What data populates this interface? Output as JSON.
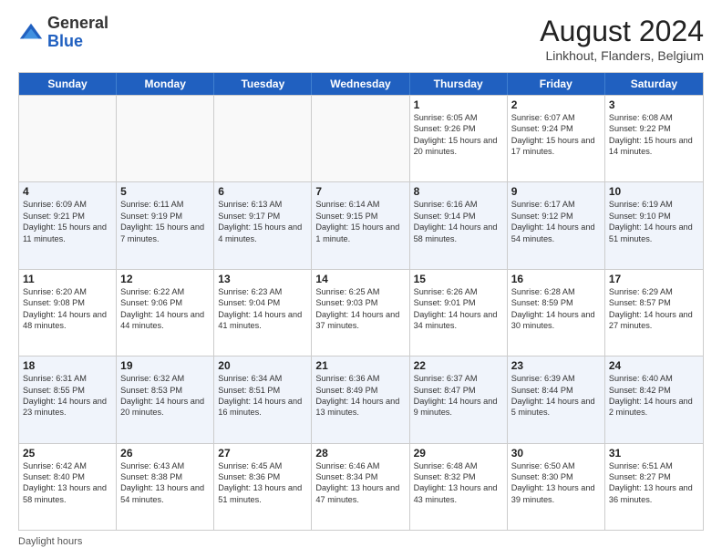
{
  "header": {
    "logo_general": "General",
    "logo_blue": "Blue",
    "month_title": "August 2024",
    "subtitle": "Linkhout, Flanders, Belgium"
  },
  "days_of_week": [
    "Sunday",
    "Monday",
    "Tuesday",
    "Wednesday",
    "Thursday",
    "Friday",
    "Saturday"
  ],
  "footer": {
    "label": "Daylight hours"
  },
  "weeks": [
    [
      {
        "day": "",
        "info": ""
      },
      {
        "day": "",
        "info": ""
      },
      {
        "day": "",
        "info": ""
      },
      {
        "day": "",
        "info": ""
      },
      {
        "day": "1",
        "info": "Sunrise: 6:05 AM\nSunset: 9:26 PM\nDaylight: 15 hours\nand 20 minutes."
      },
      {
        "day": "2",
        "info": "Sunrise: 6:07 AM\nSunset: 9:24 PM\nDaylight: 15 hours\nand 17 minutes."
      },
      {
        "day": "3",
        "info": "Sunrise: 6:08 AM\nSunset: 9:22 PM\nDaylight: 15 hours\nand 14 minutes."
      }
    ],
    [
      {
        "day": "4",
        "info": "Sunrise: 6:09 AM\nSunset: 9:21 PM\nDaylight: 15 hours\nand 11 minutes."
      },
      {
        "day": "5",
        "info": "Sunrise: 6:11 AM\nSunset: 9:19 PM\nDaylight: 15 hours\nand 7 minutes."
      },
      {
        "day": "6",
        "info": "Sunrise: 6:13 AM\nSunset: 9:17 PM\nDaylight: 15 hours\nand 4 minutes."
      },
      {
        "day": "7",
        "info": "Sunrise: 6:14 AM\nSunset: 9:15 PM\nDaylight: 15 hours\nand 1 minute."
      },
      {
        "day": "8",
        "info": "Sunrise: 6:16 AM\nSunset: 9:14 PM\nDaylight: 14 hours\nand 58 minutes."
      },
      {
        "day": "9",
        "info": "Sunrise: 6:17 AM\nSunset: 9:12 PM\nDaylight: 14 hours\nand 54 minutes."
      },
      {
        "day": "10",
        "info": "Sunrise: 6:19 AM\nSunset: 9:10 PM\nDaylight: 14 hours\nand 51 minutes."
      }
    ],
    [
      {
        "day": "11",
        "info": "Sunrise: 6:20 AM\nSunset: 9:08 PM\nDaylight: 14 hours\nand 48 minutes."
      },
      {
        "day": "12",
        "info": "Sunrise: 6:22 AM\nSunset: 9:06 PM\nDaylight: 14 hours\nand 44 minutes."
      },
      {
        "day": "13",
        "info": "Sunrise: 6:23 AM\nSunset: 9:04 PM\nDaylight: 14 hours\nand 41 minutes."
      },
      {
        "day": "14",
        "info": "Sunrise: 6:25 AM\nSunset: 9:03 PM\nDaylight: 14 hours\nand 37 minutes."
      },
      {
        "day": "15",
        "info": "Sunrise: 6:26 AM\nSunset: 9:01 PM\nDaylight: 14 hours\nand 34 minutes."
      },
      {
        "day": "16",
        "info": "Sunrise: 6:28 AM\nSunset: 8:59 PM\nDaylight: 14 hours\nand 30 minutes."
      },
      {
        "day": "17",
        "info": "Sunrise: 6:29 AM\nSunset: 8:57 PM\nDaylight: 14 hours\nand 27 minutes."
      }
    ],
    [
      {
        "day": "18",
        "info": "Sunrise: 6:31 AM\nSunset: 8:55 PM\nDaylight: 14 hours\nand 23 minutes."
      },
      {
        "day": "19",
        "info": "Sunrise: 6:32 AM\nSunset: 8:53 PM\nDaylight: 14 hours\nand 20 minutes."
      },
      {
        "day": "20",
        "info": "Sunrise: 6:34 AM\nSunset: 8:51 PM\nDaylight: 14 hours\nand 16 minutes."
      },
      {
        "day": "21",
        "info": "Sunrise: 6:36 AM\nSunset: 8:49 PM\nDaylight: 14 hours\nand 13 minutes."
      },
      {
        "day": "22",
        "info": "Sunrise: 6:37 AM\nSunset: 8:47 PM\nDaylight: 14 hours\nand 9 minutes."
      },
      {
        "day": "23",
        "info": "Sunrise: 6:39 AM\nSunset: 8:44 PM\nDaylight: 14 hours\nand 5 minutes."
      },
      {
        "day": "24",
        "info": "Sunrise: 6:40 AM\nSunset: 8:42 PM\nDaylight: 14 hours\nand 2 minutes."
      }
    ],
    [
      {
        "day": "25",
        "info": "Sunrise: 6:42 AM\nSunset: 8:40 PM\nDaylight: 13 hours\nand 58 minutes."
      },
      {
        "day": "26",
        "info": "Sunrise: 6:43 AM\nSunset: 8:38 PM\nDaylight: 13 hours\nand 54 minutes."
      },
      {
        "day": "27",
        "info": "Sunrise: 6:45 AM\nSunset: 8:36 PM\nDaylight: 13 hours\nand 51 minutes."
      },
      {
        "day": "28",
        "info": "Sunrise: 6:46 AM\nSunset: 8:34 PM\nDaylight: 13 hours\nand 47 minutes."
      },
      {
        "day": "29",
        "info": "Sunrise: 6:48 AM\nSunset: 8:32 PM\nDaylight: 13 hours\nand 43 minutes."
      },
      {
        "day": "30",
        "info": "Sunrise: 6:50 AM\nSunset: 8:30 PM\nDaylight: 13 hours\nand 39 minutes."
      },
      {
        "day": "31",
        "info": "Sunrise: 6:51 AM\nSunset: 8:27 PM\nDaylight: 13 hours\nand 36 minutes."
      }
    ]
  ]
}
